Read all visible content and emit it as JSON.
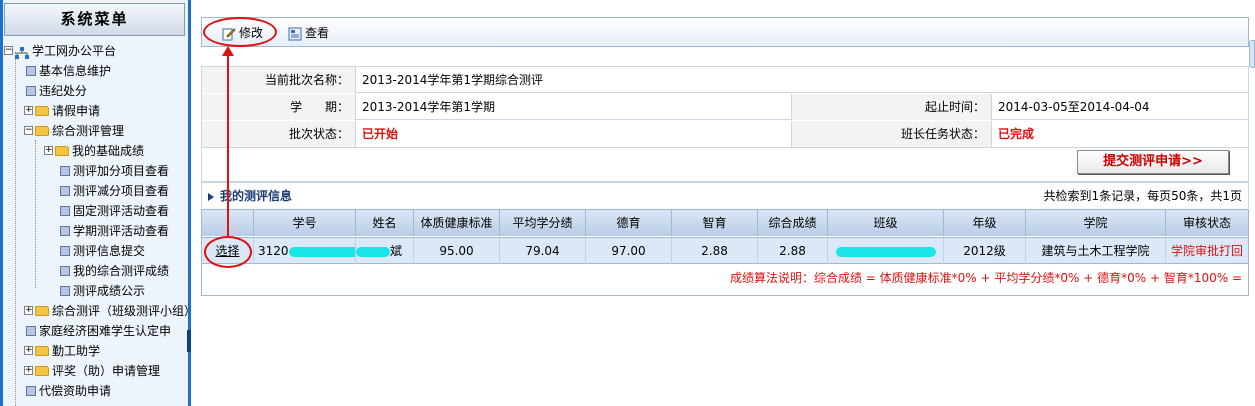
{
  "sidebar": {
    "title": "系统菜单",
    "root_label": "学工网办公平台",
    "items": [
      {
        "label": "基本信息维护",
        "type": "page"
      },
      {
        "label": "违纪处分",
        "type": "page"
      },
      {
        "label": "请假申请",
        "type": "folder"
      },
      {
        "label": "综合测评管理",
        "type": "folder-open"
      },
      {
        "label": "我的基础成绩",
        "type": "folder"
      },
      {
        "label": "测评加分项目查看",
        "type": "page"
      },
      {
        "label": "测评减分项目查看",
        "type": "page"
      },
      {
        "label": "固定测评活动查看",
        "type": "page"
      },
      {
        "label": "学期测评活动查看",
        "type": "page"
      },
      {
        "label": "测评信息提交",
        "type": "page"
      },
      {
        "label": "我的综合测评成绩",
        "type": "page"
      },
      {
        "label": "测评成绩公示",
        "type": "page"
      },
      {
        "label": "综合测评（班级测评小组）",
        "type": "folder"
      },
      {
        "label": "家庭经济困难学生认定申",
        "type": "page"
      },
      {
        "label": "勤工助学",
        "type": "folder"
      },
      {
        "label": "评奖（助）申请管理",
        "type": "folder"
      },
      {
        "label": "代偿资助申请",
        "type": "page"
      }
    ]
  },
  "toolbar": {
    "edit_label": "修改",
    "view_label": "查看",
    "edit_icon": "edit-icon",
    "view_icon": "view-icon"
  },
  "info": {
    "batch_name_label": "当前批次名称：",
    "batch_name_value": "2013-2014学年第1学期综合测评",
    "semester_label": "学      期：",
    "semester_value": "2013-2014学年第1学期",
    "period_label": "起止时间：",
    "period_value": "2014-03-05至2014-04-04",
    "batch_status_label": "批次状态：",
    "batch_status_value": "已开始",
    "monitor_status_label": "班长任务状态：",
    "monitor_status_value": "已完成"
  },
  "submit_button": "提交测评申请>>",
  "section": {
    "title": "我的测评信息",
    "summary": "共检索到1条记录，每页50条，共1页"
  },
  "table": {
    "headers": [
      "",
      "学号",
      "姓名",
      "体质健康标准",
      "平均学分绩",
      "德育",
      "智育",
      "综合成绩",
      "班级",
      "年级",
      "学院",
      "审核状态"
    ],
    "row": {
      "select": "选择",
      "student_id_prefix": "3120",
      "name_suffix": "斌",
      "health": "95.00",
      "gpa": "79.04",
      "moral": "97.00",
      "intellect": "2.88",
      "total": "2.88",
      "grade": "2012级",
      "college": "建筑与土木工程学院",
      "status": "学院审批打回"
    }
  },
  "formula": "成绩算法说明：综合成绩 = 体质健康标准*0% + 平均学分绩*0% + 德育*0% + 智育*100%  =",
  "colors": {
    "accent_blue": "#1a6fd0",
    "status_red": "#e01010",
    "mask_cyan": "#19e6e6",
    "header_bg": "#b9cde6"
  }
}
